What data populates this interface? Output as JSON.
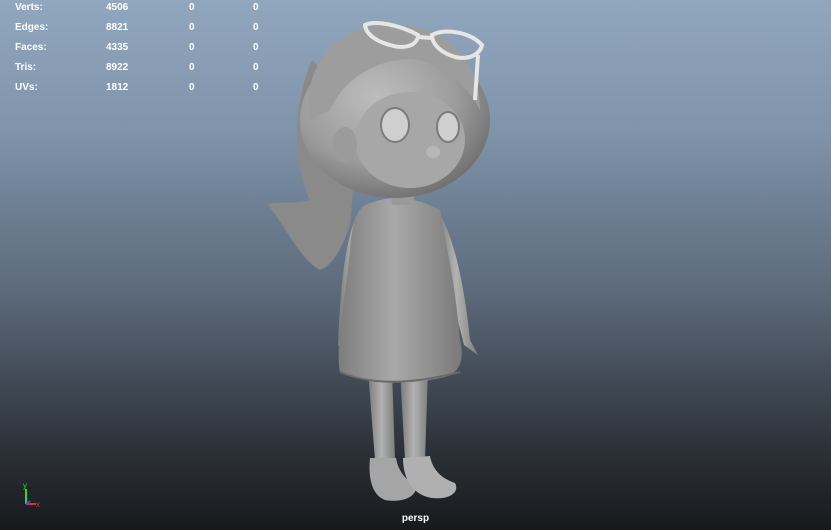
{
  "stats": [
    {
      "label": "Verts:",
      "values": [
        "4506",
        "0",
        "0"
      ]
    },
    {
      "label": "Edges:",
      "values": [
        "8821",
        "0",
        "0"
      ]
    },
    {
      "label": "Faces:",
      "values": [
        "4335",
        "0",
        "0"
      ]
    },
    {
      "label": "Tris:",
      "values": [
        "8922",
        "0",
        "0"
      ]
    },
    {
      "label": "UVs:",
      "values": [
        "1812",
        "0",
        "0"
      ]
    }
  ],
  "camera": {
    "label": "persp"
  },
  "axis": {
    "y_label": "y",
    "x_label": "x",
    "y_color": "#2fdc2f",
    "x_color": "#e03030",
    "z_color": "#3050ff"
  },
  "model": {
    "icon": "cartoon-girl-model"
  }
}
